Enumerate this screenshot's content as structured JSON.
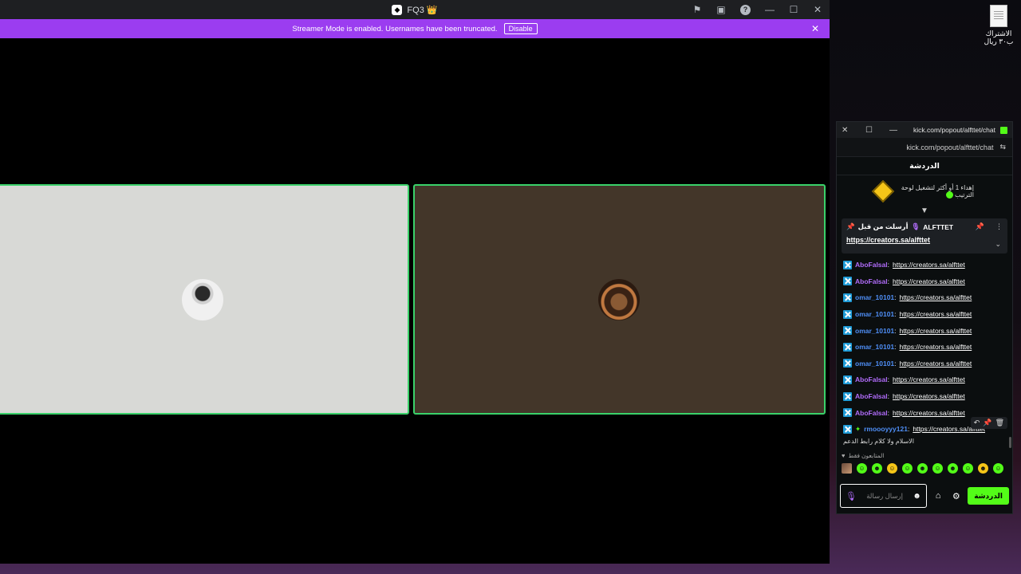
{
  "app": {
    "title": "FQ3 👑",
    "server_icon": "server-logo-icon",
    "controls": [
      "inbox-flag-icon",
      "inbox-icon",
      "help-icon",
      "minimize-icon",
      "maximize-icon",
      "close-icon"
    ],
    "help_glyph": "?"
  },
  "banner": {
    "text": "Streamer Mode is enabled. Usernames have been truncated.",
    "button_label": "Disable",
    "close_glyph": "✕",
    "color": "#9b3df0"
  },
  "video": {
    "speaking_border_color": "#3ad16a",
    "tiles": [
      {
        "name": "participant-tile-left",
        "background": "#d8d9d6"
      },
      {
        "name": "participant-tile-right",
        "background": "#433629"
      }
    ]
  },
  "desktop": {
    "file_label": "الاشتراك ب٣٠ ريال"
  },
  "chat": {
    "window_title": "kick.com/popout/alfttet/chat -...",
    "url": "kick.com/popout/alfttet/chat",
    "header": "الدردشة",
    "goal_text": "إهداء 1 أو أكثر لتشغيل لوحة الترتيب",
    "pinned": {
      "author": "ALFTTET",
      "meta": "أرسلت من قبل",
      "link": "https://creators.sa/alfttet"
    },
    "messages": [
      {
        "user": "AboFalsal",
        "color": "#b06cf9",
        "text": "https://creators.sa/alfttet"
      },
      {
        "user": "AboFalsal",
        "color": "#b06cf9",
        "text": "https://creators.sa/alfttet"
      },
      {
        "user": "omar_10101",
        "color": "#4f8ff7",
        "text": "https://creators.sa/alfttet"
      },
      {
        "user": "omar_10101",
        "color": "#4f8ff7",
        "text": "https://creators.sa/alfttet"
      },
      {
        "user": "omar_10101",
        "color": "#4f8ff7",
        "text": "https://creators.sa/alfttet"
      },
      {
        "user": "omar_10101",
        "color": "#4f8ff7",
        "text": "https://creators.sa/alfttet"
      },
      {
        "user": "omar_10101",
        "color": "#4f8ff7",
        "text": "https://creators.sa/alfttet"
      },
      {
        "user": "AboFalsal",
        "color": "#b06cf9",
        "text": "https://creators.sa/alfttet"
      },
      {
        "user": "AboFalsal",
        "color": "#b06cf9",
        "text": "https://creators.sa/alfttet"
      },
      {
        "user": "AboFalsal",
        "color": "#b06cf9",
        "text": "https://creators.sa/alfttet"
      },
      {
        "user": "rmoooyyy121",
        "color": "#4f8ff7",
        "text": "https://creators.sa/alfttet"
      }
    ],
    "last_line": "الاسلام ولا كلام رابط الدعم",
    "emote_label": "المتابعون فقط",
    "input_placeholder": "إرسال رسالة",
    "send_label": "الدردشة",
    "accent": "#53fc18"
  }
}
